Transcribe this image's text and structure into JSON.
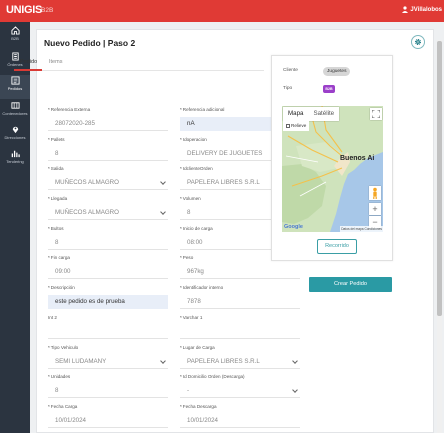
{
  "header": {
    "logo": "UNIGIS",
    "product": "B2B",
    "user": "JVillalobos"
  },
  "sidebar": [
    {
      "label": "B2B",
      "icon": "home-icon",
      "active": false
    },
    {
      "label": "Órdenes",
      "icon": "orders-icon",
      "active": false
    },
    {
      "label": "Pedidos",
      "icon": "pedidos-icon",
      "active": true
    },
    {
      "label": "Contenedores",
      "icon": "containers-icon",
      "active": false
    },
    {
      "label": "Direcciones",
      "icon": "location-icon",
      "active": false
    },
    {
      "label": "Tendering",
      "icon": "chart-icon",
      "active": false
    }
  ],
  "page": {
    "title": "Nuevo Pedido | Paso 2"
  },
  "tabs": [
    "Pedido",
    "Items"
  ],
  "form": {
    "referencia_externa": {
      "label": "Referencia Externa",
      "value": "28072020-285"
    },
    "referencia_adicional": {
      "label": "Referencia adicional",
      "value": "nA"
    },
    "pallets": {
      "label": "Pallets",
      "value": "8"
    },
    "idoperacion": {
      "label": "Idoperacion",
      "value": "DELIVERY DE JUGUETES"
    },
    "salida": {
      "label": "Salida",
      "value": "MUÑECOS ALMAGRO"
    },
    "idcliente_orden": {
      "label": "IdclienteOrden",
      "value": "PAPELERA LIBRES S.R.L"
    },
    "llegada": {
      "label": "Llegada",
      "value": "MUÑECOS ALMAGRO"
    },
    "volumen": {
      "label": "Volumen",
      "value": "8"
    },
    "bultos": {
      "label": "Bultos",
      "value": "8"
    },
    "inicio_carga": {
      "label": "Inicio de carga",
      "value": "08:00"
    },
    "fin_carga": {
      "label": "Fin carga",
      "value": "09:00"
    },
    "peso": {
      "label": "Peso",
      "value": "967kg"
    },
    "descripcion": {
      "label": "Descripción",
      "value": "este pedido es de prueba"
    },
    "identificador_interno": {
      "label": "Identificador interno",
      "value": "7878"
    },
    "int2": {
      "label": "Int 2",
      "value": ""
    },
    "varchar1": {
      "label": "Varchar 1",
      "value": ""
    },
    "tipo_vehiculo": {
      "label": "Tipo Vehiculo",
      "value": "SEMI LUDAMANY"
    },
    "lugar_carga": {
      "label": "Lugar de Carga",
      "value": "PAPELERA LIBRES S.R.L"
    },
    "unidades": {
      "label": "Unidades",
      "value": "8"
    },
    "id_domicilio_descarga": {
      "label": "Id Domicilio Orden (Descarga)",
      "value": "-"
    },
    "fecha_carga": {
      "label": "Fecha Carga",
      "value": "10/01/2024"
    },
    "fecha_descarga": {
      "label": "Fecha Descarga",
      "value": "10/01/2024"
    }
  },
  "side_panel": {
    "cliente_label": "Cliente",
    "cliente_value": "Juguetes",
    "tipo_label": "Tipo",
    "tipo_badge": "B2B",
    "map": {
      "tab_mapa": "Mapa",
      "tab_satelite": "Satélite",
      "relieve": "Relieve",
      "city": "Buenos Ai",
      "google": "Google",
      "attribution": "Datos del mapa  Condiciones"
    },
    "recorrido_label": "Recorrido"
  },
  "actions": {
    "crear_label": "Crear Pedido"
  },
  "colors": {
    "header": "#e03a35",
    "sidebar": "#2b3440",
    "accent": "#2a9aa4",
    "badge": "#9b3fc9"
  }
}
